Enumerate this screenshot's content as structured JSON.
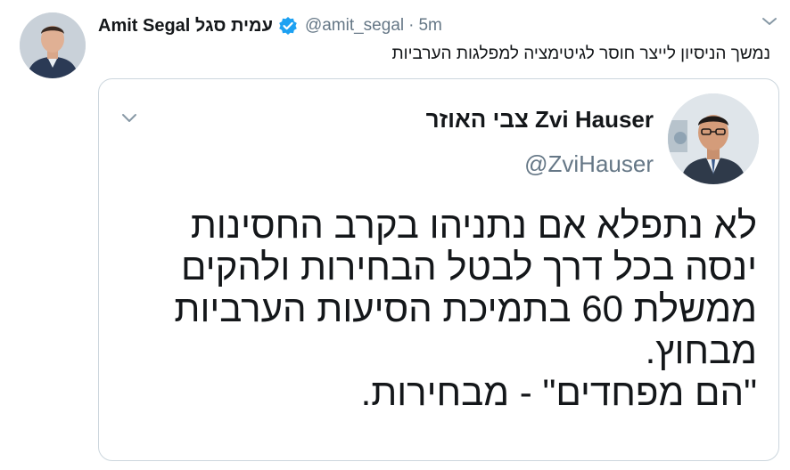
{
  "tweet": {
    "author_name": "Amit Segal עמית סגל",
    "handle": "@amit_segal",
    "separator": "·",
    "time": "5m",
    "text": "נמשך הניסיון לייצר חוסר לגיטימציה למפלגות הערביות",
    "verified": true
  },
  "quoted_tweet": {
    "author_name": "צבי האוזר Zvi Hauser",
    "handle": "@ZviHauser",
    "lines": [
      "לא נתפלא אם נתניהו בקרב החסינות",
      "ינסה בכל דרך לבטל הבחירות ולהקים",
      "ממשלת 60 בתמיכת הסיעות הערביות",
      "מבחוץ.",
      "\"הם מפחדים\" - מבחירות."
    ]
  },
  "colors": {
    "verified_badge": "#1da1f2",
    "secondary_text": "#657786",
    "border": "#ccd6dd"
  },
  "icons": [
    "avatar",
    "verified-badge-icon",
    "chevron-down-icon"
  ]
}
